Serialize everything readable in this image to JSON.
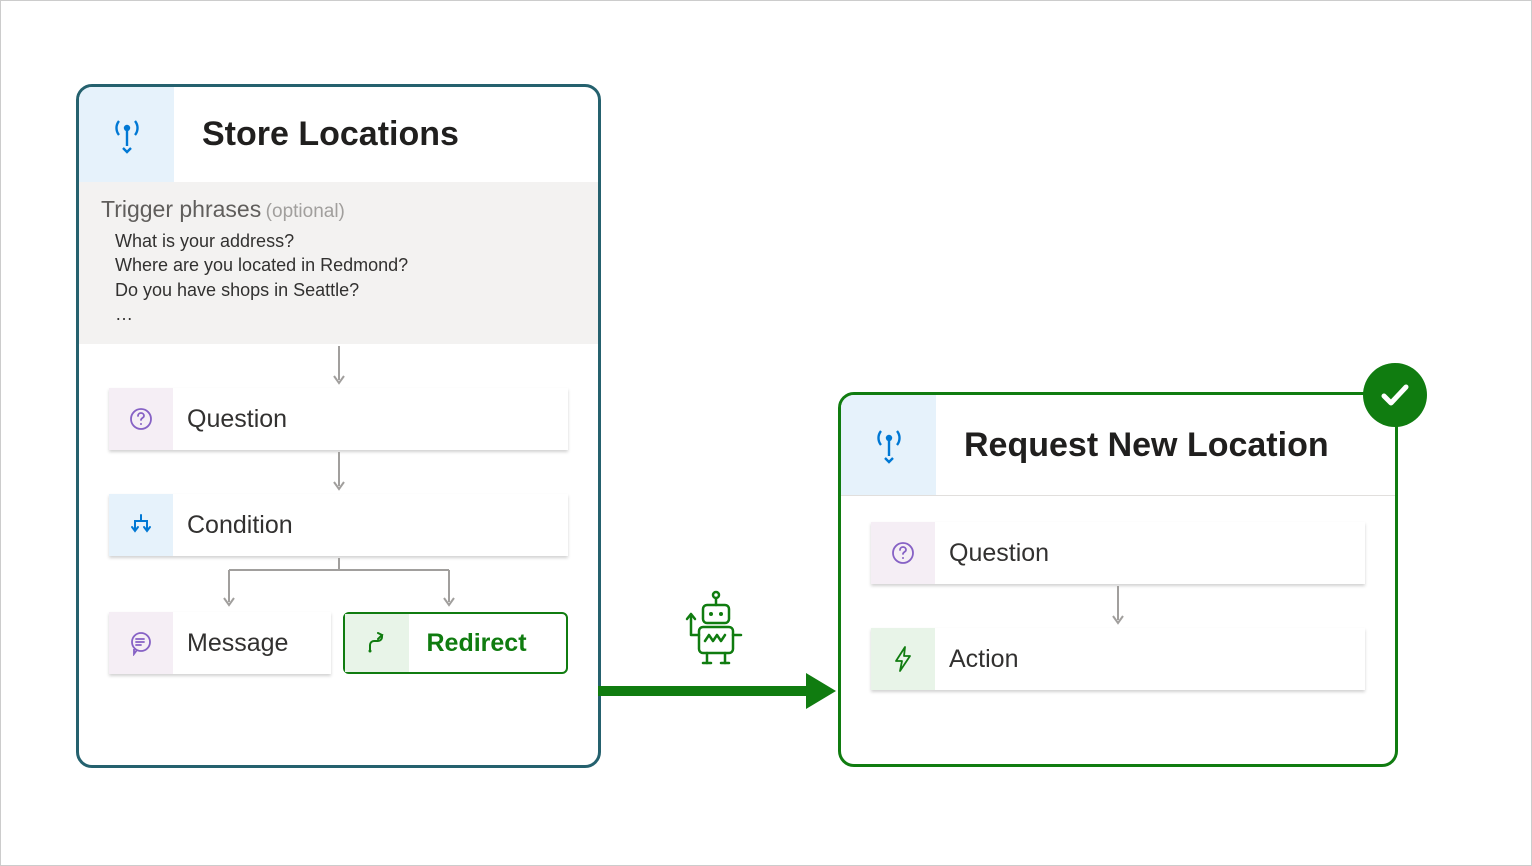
{
  "left": {
    "title": "Store Locations",
    "trigger_label": "Trigger phrases",
    "trigger_optional": "(optional)",
    "phrases": [
      "What is your address?",
      "Where are you located in Redmond?",
      "Do you have shops in Seattle?",
      "…"
    ],
    "nodes": {
      "question": "Question",
      "condition": "Condition",
      "message": "Message",
      "redirect": "Redirect"
    }
  },
  "right": {
    "title": "Request New Location",
    "nodes": {
      "question": "Question",
      "action": "Action"
    }
  },
  "colors": {
    "green": "#107c10",
    "teal": "#25616e",
    "blue_icon": "#0078d4",
    "purple": "#8661c5",
    "grey_line": "#a19f9d"
  }
}
